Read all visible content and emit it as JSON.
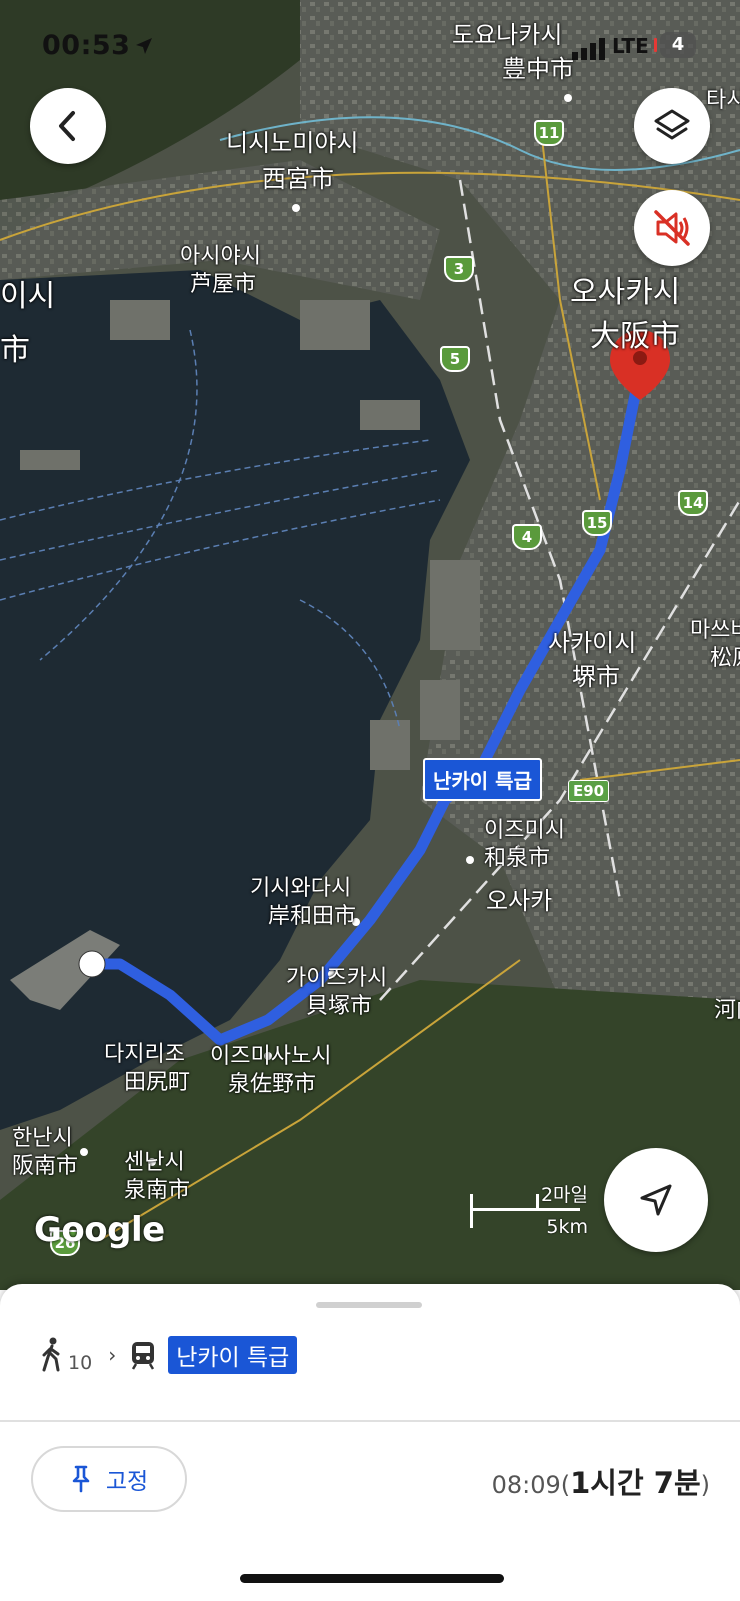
{
  "status_bar": {
    "time": "00:53",
    "network": "LTE",
    "battery": "4"
  },
  "map": {
    "labels": [
      "도요나카시",
      "豊中市",
      "니시노미야시",
      "西宮市",
      "아시야시",
      "芦屋市",
      "오사카시",
      "大阪市",
      "사카이시",
      "堺市",
      "이즈미시",
      "和泉市",
      "오사카",
      "기시와다시",
      "岸和田市",
      "가이즈카시",
      "貝塚市",
      "다지리조",
      "田尻町",
      "이즈미사노시",
      "泉佐野市",
      "한난시",
      "阪南市",
      "센난시",
      "泉南市",
      "마쓰바",
      "松原",
      "河内",
      "타시",
      "이시",
      "市"
    ],
    "highway_badges": [
      "11",
      "3",
      "5",
      "14",
      "4",
      "15",
      "E90",
      "26"
    ],
    "route_label": "난카이 특급",
    "attribution": "Google",
    "scale": {
      "imperial": "2마일",
      "metric": "5km"
    }
  },
  "sheet": {
    "walk_minutes": "10",
    "train_label": "난카이 특급",
    "pin_label": "고정",
    "depart_time": "08:09",
    "duration": "1시간 7분"
  },
  "colors": {
    "route": "#2f5fe0",
    "accent": "#1a56d6",
    "destination_pin": "#d93025"
  }
}
